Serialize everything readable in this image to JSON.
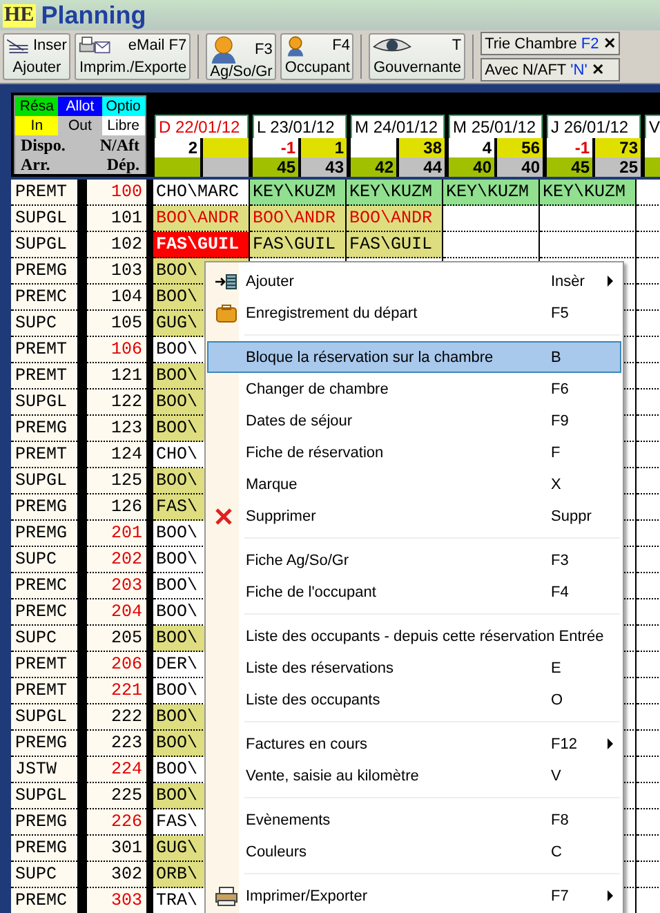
{
  "window": {
    "logo": "HE",
    "title": "Planning"
  },
  "toolbar": [
    {
      "kind": "insert",
      "key": "Inser",
      "label": "Ajouter"
    },
    {
      "kind": "email",
      "key": "eMail  F7",
      "label": "Imprim./Exporte"
    },
    {
      "kind": "person",
      "key": "F3",
      "label": "Ag/So/Gr"
    },
    {
      "kind": "occupant",
      "key": "F4",
      "label": "Occupant"
    },
    {
      "kind": "eye",
      "key": "T",
      "label": "Gouvernante"
    }
  ],
  "filters": [
    {
      "label": "Trie Chambre",
      "key": "F2",
      "close": "✕"
    },
    {
      "label": "Avec N/AFT",
      "key": "'N'",
      "close": "✕"
    }
  ],
  "legend": {
    "items": [
      {
        "label": "Résa",
        "color": "#00e000"
      },
      {
        "label": "Allot",
        "color": "#0000ff"
      },
      {
        "label": "Optio",
        "color": "#00ffff"
      },
      {
        "label": "In",
        "color": "#ffff00"
      },
      {
        "label": "Out",
        "color": "#c0c0c0"
      },
      {
        "label": "Libre",
        "color": "#ffffff"
      }
    ],
    "row_1": [
      "Dispo.",
      "N/Aft"
    ],
    "row_2": [
      "Arr.",
      "Dép."
    ]
  },
  "days": [
    {
      "date": "D 22/01/12",
      "weekend": true,
      "dispo": "2"
    },
    {
      "date": "L 23/01/12",
      "weekend": false,
      "dispo": "-1",
      "n_aft": "1",
      "arr": "45",
      "dep": "43"
    },
    {
      "date": "M 24/01/12",
      "weekend": false,
      "n_aft": "38",
      "arr": "42",
      "dep": "44"
    },
    {
      "date": "M 25/01/12",
      "weekend": false,
      "dispo": "4",
      "n_aft": "56",
      "arr": "40",
      "dep": "40"
    },
    {
      "date": "J 26/01/12",
      "weekend": false,
      "dispo": "-1",
      "n_aft": "73",
      "arr": "45",
      "dep": "25"
    },
    {
      "date": "V",
      "weekend": false
    }
  ],
  "rooms": [
    {
      "type": "PREMT",
      "number": "100",
      "flagged": true,
      "cells": [
        {
          "text": "CHO\\MARC",
          "color": "#ffffff",
          "alert": false,
          "selected": false
        },
        {
          "text": "KEY\\KUZM",
          "color": "#90e090",
          "alert": false,
          "selected": false
        },
        {
          "text": "KEY\\KUZM",
          "color": "#90e090",
          "alert": false,
          "selected": false
        },
        {
          "text": "KEY\\KUZM",
          "color": "#90e090",
          "alert": false,
          "selected": false
        },
        {
          "text": "KEY\\KUZM",
          "color": "#90e090",
          "alert": false,
          "selected": false
        }
      ]
    },
    {
      "type": "SUPGL",
      "number": "101",
      "flagged": false,
      "cells": [
        {
          "text": "BOO\\ANDR",
          "color": "#dede80",
          "alert": true,
          "selected": false
        },
        {
          "text": "BOO\\ANDR",
          "color": "#dede80",
          "alert": true,
          "selected": false
        },
        {
          "text": "BOO\\ANDR",
          "color": "#dede80",
          "alert": true,
          "selected": false
        }
      ]
    },
    {
      "type": "SUPGL",
      "number": "102",
      "flagged": false,
      "cells": [
        {
          "text": "FAS\\GUIL",
          "color": "#ff0000",
          "alert": false,
          "selected": true
        },
        {
          "text": "FAS\\GUIL",
          "color": "#dede80",
          "alert": false,
          "selected": false
        },
        {
          "text": "FAS\\GUIL",
          "color": "#dede80",
          "alert": false,
          "selected": false
        }
      ]
    },
    {
      "type": "PREMG",
      "number": "103",
      "flagged": false,
      "cells": [
        {
          "text": "BOO\\",
          "color": "#dede80",
          "alert": false,
          "selected": false
        }
      ]
    },
    {
      "type": "PREMC",
      "number": "104",
      "flagged": false,
      "cells": [
        {
          "text": "BOO\\",
          "color": "#dede80",
          "alert": false,
          "selected": false
        }
      ]
    },
    {
      "type": "SUPC",
      "number": "105",
      "flagged": false,
      "cells": [
        {
          "text": "GUG\\",
          "color": "#dede80",
          "alert": false,
          "selected": false
        }
      ]
    },
    {
      "type": "PREMT",
      "number": "106",
      "flagged": true,
      "cells": [
        {
          "text": "BOO\\",
          "color": "#ffffff",
          "alert": false,
          "selected": false
        }
      ]
    },
    {
      "type": "PREMT",
      "number": "121",
      "flagged": false,
      "cells": [
        {
          "text": "BOO\\",
          "color": "#dede80",
          "alert": false,
          "selected": false
        }
      ]
    },
    {
      "type": "SUPGL",
      "number": "122",
      "flagged": false,
      "cells": [
        {
          "text": "BOO\\",
          "color": "#dede80",
          "alert": false,
          "selected": false
        }
      ]
    },
    {
      "type": "PREMG",
      "number": "123",
      "flagged": false,
      "cells": [
        {
          "text": "BOO\\",
          "color": "#dede80",
          "alert": false,
          "selected": false
        }
      ]
    },
    {
      "type": "PREMT",
      "number": "124",
      "flagged": false,
      "cells": [
        {
          "text": "CHO\\",
          "color": "#ffffff",
          "alert": false,
          "selected": false
        }
      ]
    },
    {
      "type": "SUPGL",
      "number": "125",
      "flagged": false,
      "cells": [
        {
          "text": "BOO\\",
          "color": "#dede80",
          "alert": false,
          "selected": false
        }
      ]
    },
    {
      "type": "PREMG",
      "number": "126",
      "flagged": false,
      "cells": [
        {
          "text": "FAS\\",
          "color": "#dede80",
          "alert": false,
          "selected": false
        }
      ]
    },
    {
      "type": "PREMG",
      "number": "201",
      "flagged": true,
      "cells": [
        {
          "text": "BOO\\",
          "color": "#ffffff",
          "alert": false,
          "selected": false
        }
      ]
    },
    {
      "type": "SUPC",
      "number": "202",
      "flagged": true,
      "cells": [
        {
          "text": "BOO\\",
          "color": "#ffffff",
          "alert": false,
          "selected": false
        }
      ]
    },
    {
      "type": "PREMC",
      "number": "203",
      "flagged": true,
      "cells": [
        {
          "text": "BOO\\",
          "color": "#ffffff",
          "alert": false,
          "selected": false
        }
      ]
    },
    {
      "type": "PREMC",
      "number": "204",
      "flagged": true,
      "cells": [
        {
          "text": "BOO\\",
          "color": "#ffffff",
          "alert": false,
          "selected": false
        }
      ]
    },
    {
      "type": "SUPC",
      "number": "205",
      "flagged": false,
      "cells": [
        {
          "text": "BOO\\",
          "color": "#dede80",
          "alert": false,
          "selected": false
        }
      ]
    },
    {
      "type": "PREMT",
      "number": "206",
      "flagged": true,
      "cells": [
        {
          "text": "DER\\",
          "color": "#ffffff",
          "alert": false,
          "selected": false
        }
      ]
    },
    {
      "type": "PREMT",
      "number": "221",
      "flagged": true,
      "cells": [
        {
          "text": "BOO\\",
          "color": "#ffffff",
          "alert": false,
          "selected": false
        }
      ]
    },
    {
      "type": "SUPGL",
      "number": "222",
      "flagged": false,
      "cells": [
        {
          "text": "BOO\\",
          "color": "#dede80",
          "alert": false,
          "selected": false
        }
      ]
    },
    {
      "type": "PREMG",
      "number": "223",
      "flagged": false,
      "cells": [
        {
          "text": "BOO\\",
          "color": "#dede80",
          "alert": false,
          "selected": false
        }
      ]
    },
    {
      "type": "JSTW",
      "number": "224",
      "flagged": true,
      "cells": [
        {
          "text": "BOO\\",
          "color": "#ffffff",
          "alert": false,
          "selected": false
        }
      ]
    },
    {
      "type": "SUPGL",
      "number": "225",
      "flagged": false,
      "cells": [
        {
          "text": "BOO\\",
          "color": "#dede80",
          "alert": false,
          "selected": false
        }
      ]
    },
    {
      "type": "PREMG",
      "number": "226",
      "flagged": true,
      "cells": [
        {
          "text": "FAS\\",
          "color": "#ffffff",
          "alert": false,
          "selected": false
        }
      ]
    },
    {
      "type": "PREMG",
      "number": "301",
      "flagged": false,
      "cells": [
        {
          "text": "GUG\\",
          "color": "#dede80",
          "alert": false,
          "selected": false
        }
      ]
    },
    {
      "type": "SUPC",
      "number": "302",
      "flagged": false,
      "cells": [
        {
          "text": "ORB\\",
          "color": "#dede80",
          "alert": false,
          "selected": false
        }
      ]
    },
    {
      "type": "PREMC",
      "number": "303",
      "flagged": true,
      "cells": [
        {
          "text": "TRA\\",
          "color": "#ffffff",
          "alert": false,
          "selected": false
        }
      ]
    }
  ],
  "context_menu": [
    {
      "kind": "insert",
      "label": "Ajouter",
      "shortcut": "Insèr",
      "submenu": true,
      "selected": false
    },
    {
      "kind": "depart",
      "label": "Enregistrement du départ",
      "shortcut": "F5",
      "submenu": false,
      "selected": false
    },
    {
      "kind": "separator"
    },
    {
      "kind": "plain",
      "label": "Bloque la réservation sur la chambre",
      "shortcut": "B",
      "submenu": false,
      "selected": true
    },
    {
      "kind": "plain",
      "label": "Changer de chambre",
      "shortcut": "F6",
      "submenu": false,
      "selected": false
    },
    {
      "kind": "plain",
      "label": "Dates de séjour",
      "shortcut": "F9",
      "submenu": false,
      "selected": false
    },
    {
      "kind": "plain",
      "label": "Fiche de réservation",
      "shortcut": "F",
      "submenu": false,
      "selected": false
    },
    {
      "kind": "plain",
      "label": "Marque",
      "shortcut": "X",
      "submenu": false,
      "selected": false
    },
    {
      "kind": "delete",
      "label": "Supprimer",
      "shortcut": "Suppr",
      "submenu": false,
      "selected": false
    },
    {
      "kind": "separator"
    },
    {
      "kind": "plain",
      "label": "Fiche Ag/So/Gr",
      "shortcut": "F3",
      "submenu": false,
      "selected": false
    },
    {
      "kind": "plain",
      "label": "Fiche de l'occupant",
      "shortcut": "F4",
      "submenu": false,
      "selected": false
    },
    {
      "kind": "separator"
    },
    {
      "kind": "plain",
      "label": "Liste des occupants - depuis cette réservation",
      "shortcut": "Entrée",
      "submenu": false,
      "selected": false
    },
    {
      "kind": "plain",
      "label": "Liste des réservations",
      "shortcut": "E",
      "submenu": false,
      "selected": false
    },
    {
      "kind": "plain",
      "label": "Liste des occupants",
      "shortcut": "O",
      "submenu": false,
      "selected": false
    },
    {
      "kind": "separator"
    },
    {
      "kind": "plain",
      "label": "Factures en cours",
      "shortcut": "F12",
      "submenu": true,
      "selected": false
    },
    {
      "kind": "plain",
      "label": "Vente, saisie au kilomètre",
      "shortcut": "V",
      "submenu": false,
      "selected": false
    },
    {
      "kind": "separator"
    },
    {
      "kind": "plain",
      "label": "Evènements",
      "shortcut": "F8",
      "submenu": false,
      "selected": false
    },
    {
      "kind": "plain",
      "label": "Couleurs",
      "shortcut": "C",
      "submenu": false,
      "selected": false
    },
    {
      "kind": "separator"
    },
    {
      "kind": "print",
      "label": "Imprimer/Exporter",
      "shortcut": "F7",
      "submenu": true,
      "selected": false
    }
  ]
}
